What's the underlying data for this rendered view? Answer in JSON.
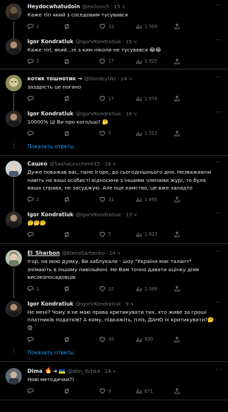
{
  "tweets": [
    {
      "name": "Heydocwhatudoin",
      "handle": "@exilovich",
      "time": "15 ч",
      "text": "Каже тіп який з соседовим тусувався",
      "replies": "2",
      "retweets": "",
      "likes": "33",
      "views": "1 509"
    },
    {
      "name": "Igor Kondratiuk",
      "handle": "@IgorVKondratiuk",
      "time": "15 ч",
      "text": "Каже тіп, який...ні з ким ніколи не тусувався 😂😂",
      "replies": "2",
      "retweets": "",
      "likes": "17",
      "views": "1 925"
    },
    {
      "name": "котик тошнотик →",
      "handle": "@GordeyUkr",
      "time": "14 ч",
      "text": "заздрість це погано",
      "replies": "",
      "retweets": "",
      "likes": "17",
      "views": "1 578"
    },
    {
      "name": "Igor Kondratiuk",
      "handle": "@IgorVKondratiuk",
      "time": "14 ч",
      "text": "10000% Ці Ви про кого/що? 🤔",
      "replies": "",
      "retweets": "",
      "likes": "5",
      "views": "1 512"
    },
    {
      "name": "Сашко",
      "handle": "@SashaLevchenk15",
      "time": "14 ч",
      "text": "Дуже поважав вас, пане Ігоре, до сьогоднішнього дня. Незважаючи навіть на ваші особисті відносини  з іншими членами журі, то була ваша справа, не засуджую. Але оце хамство, це вже занадто",
      "replies": "2",
      "retweets": "",
      "likes": "31",
      "views": "1 895"
    },
    {
      "name": "Igor Kondratiuk",
      "handle": "@IgorVKondratiuk",
      "time": "13 ч",
      "text": "🤔🤔🤔",
      "replies": "",
      "retweets": "",
      "likes": "5",
      "views": "1 623"
    },
    {
      "name": "El_Sharbon",
      "handle": "@ElenaSarbenko",
      "time": "14 ч",
      "text": "Ігор, на мою думку, Ви заблукали - шоу \"Україна має талант\" знімають в іншому павільйоні. Не Вам точно давати оцінку діям високопосадовців",
      "replies": "1",
      "retweets": "",
      "likes": "32",
      "views": "1 099"
    },
    {
      "name": "Igor Kondratiuk",
      "handle": "@IgorVKondratiuk",
      "time": "9 ч",
      "text": "Не мені? Чому я не маю права критикувати тих, хто живе за гроші платників податків? А кому, підкажіть, пліз, ДАНО їх критикувати?🤔😊",
      "replies": "",
      "retweets": "",
      "likes": "30",
      "views": "930"
    },
    {
      "name": "Dima",
      "handle": "@dim_0chk4",
      "time": "14 ч",
      "text": "Нові методички?)",
      "replies": "",
      "retweets": "",
      "likes": "9",
      "views": "671"
    }
  ],
  "show_replies_label": "Показать ответы",
  "colors": {
    "background": "#000000",
    "text": "#e7e9ea",
    "secondary": "#71767b",
    "accent": "#1d9bf0",
    "divider": "#2f3336"
  },
  "icons": [
    "reply-icon",
    "retweet-icon",
    "like-icon",
    "views-icon",
    "share-icon",
    "more-icon"
  ]
}
